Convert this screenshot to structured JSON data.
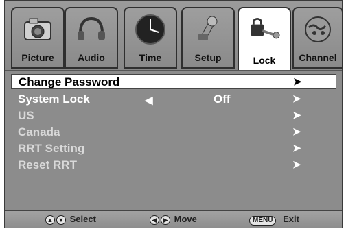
{
  "tabs": [
    {
      "label": "Picture",
      "icon": "camera-icon"
    },
    {
      "label": "Audio",
      "icon": "headphones-icon"
    },
    {
      "label": "Time",
      "icon": "clock-icon"
    },
    {
      "label": "Setup",
      "icon": "tools-icon"
    },
    {
      "label": "Lock",
      "icon": "lock-key-icon",
      "active": true
    },
    {
      "label": "Channel",
      "icon": "globe-icon"
    }
  ],
  "menu": {
    "items": [
      {
        "label": "Change Password",
        "arrow": "➤",
        "selected": true
      },
      {
        "label": "System Lock",
        "left": "◀",
        "value": "Off",
        "arrow": "➤"
      },
      {
        "label": "US",
        "arrow": "➤"
      },
      {
        "label": "Canada",
        "arrow": "➤"
      },
      {
        "label": "RRT Setting",
        "arrow": "➤"
      },
      {
        "label": "Reset RRT",
        "arrow": "➤"
      }
    ]
  },
  "footer": {
    "select_label": "Select",
    "move_label": "Move",
    "menu_key": "MENU",
    "exit_label": "Exit"
  }
}
